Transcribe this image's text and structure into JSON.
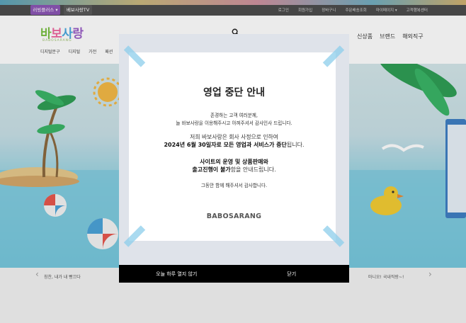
{
  "topbar": {
    "tab_primary": "러빙플러스 ▾",
    "tab_secondary": "베보사랑TV",
    "util_links": [
      "로그인",
      "회원가입",
      "장바구니",
      "주문배송조회",
      "마이페이지 ▾",
      "고객행복센터"
    ]
  },
  "header": {
    "logo_text": [
      "바",
      "보",
      "사",
      "랑"
    ],
    "logo_sub": "BABOSARANG",
    "right_nav": [
      "신상품",
      "브랜드",
      "해외직구"
    ],
    "cat_nav": [
      "디지털문구",
      "디지털",
      "가전",
      "패션"
    ]
  },
  "below": {
    "left_text": "칭찬, 내가 내 빵끄다",
    "right_text": "마니오! 국내직랑~!"
  },
  "modal": {
    "title": "영업 중단 안내",
    "line1": "존경하는 고객 여러분께,",
    "line2": "늘 바보사랑을 이용해주시고 아껴주셔서 감사인사 드립니다.",
    "line3": "저희 바보사랑은 회사 사정으로 인하여",
    "line4_bold": "2024년 6월 30일자로 모든 영업과 서비스가 중단",
    "line4_rest": "됩니다.",
    "line5": "사이트의 운영 및 상품판매와",
    "line6_bold": "출고진행이 불가",
    "line6_rest": "함을 안내드립니다.",
    "line7": "그동안 함께 해주셔서 감사합니다.",
    "brand": "BABOSARANG",
    "btn_hide_today": "오늘 하루 열지 않기",
    "btn_close": "닫기"
  },
  "colors": {
    "modal_bg": "#dfe3ea",
    "footer_bg": "#000000",
    "tape": "#8ccdeb",
    "tab_primary": "#8b56b5"
  }
}
